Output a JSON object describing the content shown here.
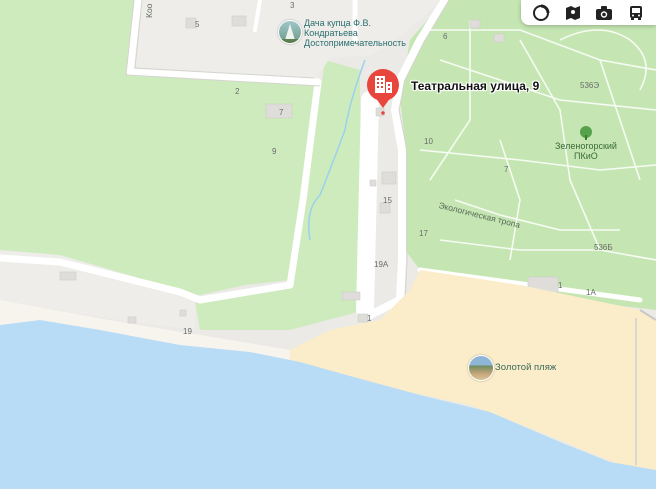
{
  "map": {
    "colors": {
      "background": "#ebeae6",
      "park": "#cdebbd",
      "park_dark": "#c5e6b2",
      "water": "#b8dcf5",
      "beach": "#fbedc9",
      "road": "#ffffff",
      "building": "#dfddd9",
      "pin": "#e8453c"
    },
    "pin": {
      "label": "Театральная улица, 9",
      "icon": "building-icon"
    },
    "pois": [
      {
        "name": "Дача купца Ф.В. Кондратьева",
        "lines": [
          "Дача купца Ф.В.",
          "Кондратьева"
        ],
        "category": "Достопримечательность",
        "icon": "monument-thumbnail"
      },
      {
        "name": "Зеленогорский ПКиО",
        "lines": [
          "Зеленогорский",
          "ПКиО"
        ],
        "icon": "park-icon"
      },
      {
        "name": "Золотой пляж",
        "icon": "beach-thumbnail"
      }
    ],
    "streets": [
      {
        "name": "Экологическая тропа"
      },
      {
        "name": "Коо"
      }
    ],
    "house_numbers": [
      "3",
      "5",
      "2",
      "7",
      "9",
      "6",
      "10",
      "7",
      "15",
      "17",
      "19А",
      "1",
      "1А",
      "19",
      "536Б",
      "536Э"
    ],
    "toolbar": [
      {
        "name": "traffic-button",
        "icon": "traffic-icon"
      },
      {
        "name": "panorama-button",
        "icon": "panorama-icon"
      },
      {
        "name": "photos-button",
        "icon": "camera-icon"
      },
      {
        "name": "transit-button",
        "icon": "bus-icon"
      }
    ]
  }
}
